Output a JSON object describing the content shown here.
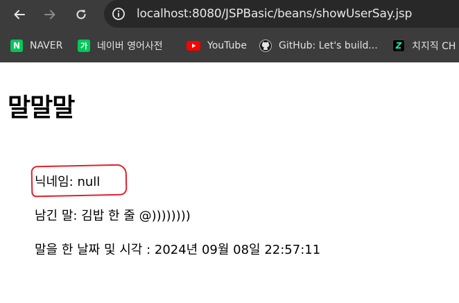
{
  "browser": {
    "url_host": "localhost",
    "url_rest": ":8080/JSPBasic/beans/showUserSay.jsp"
  },
  "bookmarks": [
    {
      "label": "NAVER",
      "icon": "naver-icon",
      "color": "#03c75a"
    },
    {
      "label": "네이버 영어사전",
      "icon": "naver-dictionary-icon",
      "color": "#03c75a"
    },
    {
      "label": "YouTube",
      "icon": "youtube-icon",
      "color": "#ff0000"
    },
    {
      "label": "GitHub: Let's build...",
      "icon": "github-icon",
      "color": "#e3e3e3"
    },
    {
      "label": "치지직 CH",
      "icon": "chzzk-icon",
      "color": "#00ffa3"
    }
  ],
  "page": {
    "title": "말말말",
    "nickname_line": "닉네임: null",
    "message_line": "남긴 말: 김밥 한 줄 @))))))))",
    "datetime_line": "말을 한 날짜 및 시각 : 2024년 09월 08일 22:57:11"
  },
  "annotation_color": "#e0202a"
}
